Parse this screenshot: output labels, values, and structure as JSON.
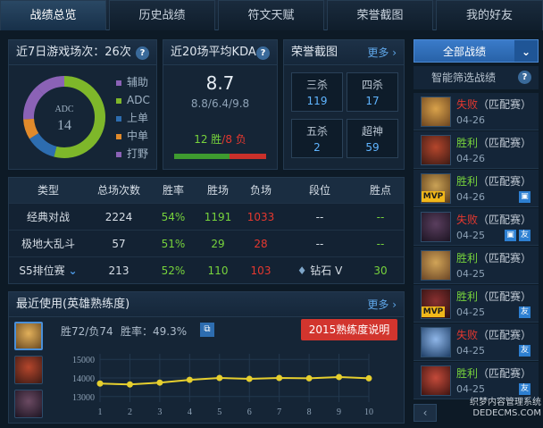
{
  "tabs": [
    "战绩总览",
    "历史战绩",
    "符文天赋",
    "荣誉截图",
    "我的好友"
  ],
  "games7": {
    "title": "近7日游戏场次：26次",
    "center_role": "ADC",
    "center_count": "14",
    "legend": [
      {
        "label": "辅助",
        "color": "#8b62b6"
      },
      {
        "label": "ADC",
        "color": "#7eb72a"
      },
      {
        "label": "上单",
        "color": "#2d6db0"
      },
      {
        "label": "中单",
        "color": "#e08a2b"
      },
      {
        "label": "打野",
        "color": "#8b62b6"
      }
    ]
  },
  "kda": {
    "title": "近20场平均KDA",
    "value": "8.7",
    "breakdown": "8.8/6.4/9.8",
    "wins": "12 胜",
    "slash": "/",
    "losses": "8 负",
    "win_fraction": 0.6
  },
  "honor": {
    "title": "荣誉截图",
    "more": "更多",
    "items": [
      {
        "label": "三杀",
        "count": "119"
      },
      {
        "label": "四杀",
        "count": "17"
      },
      {
        "label": "五杀",
        "count": "2"
      },
      {
        "label": "超神",
        "count": "59"
      }
    ]
  },
  "stats": {
    "headers": [
      "类型",
      "总场次数",
      "胜率",
      "胜场",
      "负场",
      "段位",
      "胜点"
    ],
    "rows": [
      {
        "type": "经典对战",
        "total": "2224",
        "rate": "54%",
        "wins": "1191",
        "losses": "1033",
        "rank": "--",
        "points": "--"
      },
      {
        "type": "极地大乱斗",
        "total": "57",
        "rate": "51%",
        "wins": "29",
        "losses": "28",
        "rank": "--",
        "points": "--"
      },
      {
        "type": "S5排位赛",
        "total": "213",
        "rate": "52%",
        "wins": "110",
        "losses": "103",
        "rank": "钻石 V",
        "points": "30"
      }
    ]
  },
  "recent": {
    "title": "最近使用(英雄熟练度)",
    "more": "更多",
    "record": "胜72/负74",
    "winrate": "胜率：49.3%",
    "button_2015": "2015熟练度说明"
  },
  "chart_data": {
    "type": "line",
    "x": [
      1,
      2,
      3,
      4,
      5,
      6,
      7,
      8,
      9,
      10
    ],
    "y": [
      13700,
      13650,
      13750,
      13900,
      14000,
      13950,
      14000,
      13980,
      14050,
      13980
    ],
    "yticks": [
      13000,
      14000,
      15000
    ],
    "ylim": [
      12700,
      15300
    ],
    "color": "#e6cf2e"
  },
  "sidebar": {
    "dropdown_label": "全部战绩",
    "filter_label": "智能筛选战绩",
    "matches": [
      {
        "result": "失败",
        "mode": "（匹配赛）",
        "date": "04-26",
        "win": false,
        "mvp": false,
        "tags": []
      },
      {
        "result": "胜利",
        "mode": "（匹配赛）",
        "date": "04-26",
        "win": true,
        "mvp": false,
        "tags": []
      },
      {
        "result": "胜利",
        "mode": "（匹配赛）",
        "date": "04-26",
        "win": true,
        "mvp": true,
        "tags": [
          "img"
        ]
      },
      {
        "result": "失败",
        "mode": "（匹配赛）",
        "date": "04-25",
        "win": false,
        "mvp": false,
        "tags": [
          "img",
          "友"
        ]
      },
      {
        "result": "胜利",
        "mode": "（匹配赛）",
        "date": "04-25",
        "win": true,
        "mvp": false,
        "tags": []
      },
      {
        "result": "胜利",
        "mode": "（匹配赛）",
        "date": "04-25",
        "win": true,
        "mvp": true,
        "tags": [
          "友"
        ]
      },
      {
        "result": "失败",
        "mode": "（匹配赛）",
        "date": "04-25",
        "win": false,
        "mvp": false,
        "tags": [
          "友"
        ]
      },
      {
        "result": "胜利",
        "mode": "（匹配赛）",
        "date": "04-25",
        "win": true,
        "mvp": false,
        "tags": [
          "友"
        ]
      }
    ],
    "watermark": "织梦内容管理系统 DEDECMS.COM"
  }
}
